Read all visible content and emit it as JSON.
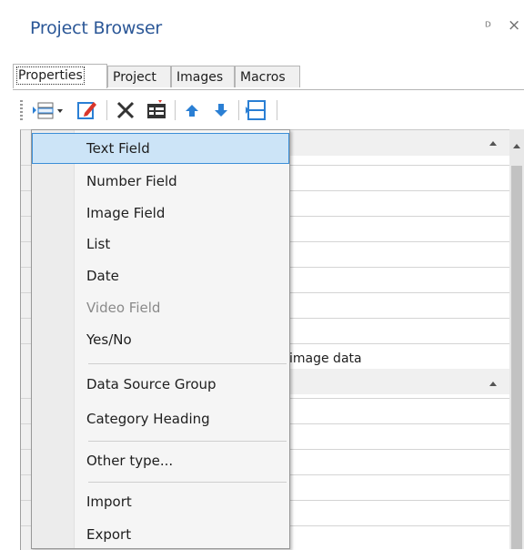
{
  "panel": {
    "title": "Project Browser"
  },
  "tabs": [
    {
      "label": "Properties",
      "active": true
    },
    {
      "label": "Project"
    },
    {
      "label": "Images"
    },
    {
      "label": "Macros"
    }
  ],
  "toolbar": {
    "buttons": [
      "add-field-dropdown-icon",
      "edit-icon",
      "delete-icon",
      "table-icon",
      "move-up-icon",
      "move-down-icon",
      "split-icon"
    ]
  },
  "grid": {
    "visible_text": "image data"
  },
  "menu": {
    "items": [
      {
        "label": "Text Field"
      },
      {
        "label": "Number Field"
      },
      {
        "label": "Image Field"
      },
      {
        "label": "List"
      },
      {
        "label": "Date"
      },
      {
        "label": "Video Field"
      },
      {
        "label": "Yes/No"
      },
      {
        "label": "Data Source Group"
      },
      {
        "label": "Category Heading"
      },
      {
        "label": "Other type..."
      },
      {
        "label": "Import"
      },
      {
        "label": "Export"
      }
    ]
  },
  "colors": {
    "title": "#2b5797",
    "selection": "#cce4f7",
    "selection_border": "#3c8fd8",
    "disabled": "#8a8a8a"
  }
}
